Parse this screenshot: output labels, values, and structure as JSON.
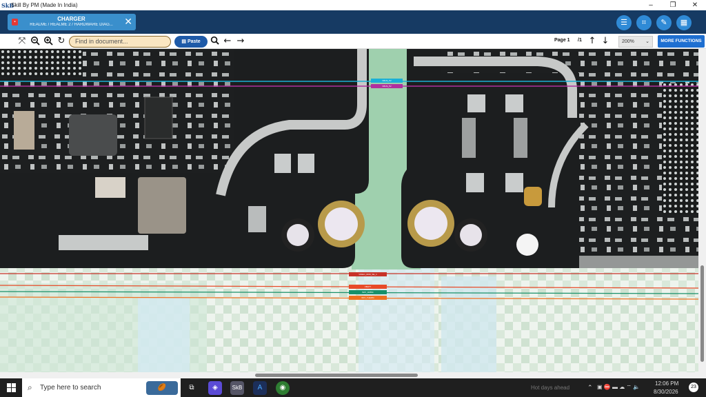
{
  "window": {
    "app_icon": "SkB",
    "title": "Skill By PM (Made In India)",
    "controls": [
      "minimize-icon",
      "restore-icon",
      "close-icon"
    ]
  },
  "header": {
    "doc_tab": {
      "title": "CHARGER",
      "subtitle": "REALME / REALME 2 / HARDWARE DIAG...",
      "close": "✕"
    },
    "buttons": [
      "menu-icon",
      "crop-icon",
      "edit-icon",
      "grid-icon"
    ]
  },
  "toolbar": {
    "search_placeholder": "Find in document...",
    "paste_label": "Paste",
    "page_label": "Page 1",
    "page_total": "/1",
    "zoom_value": "200%",
    "more_label": "MORE FUNCTIONS"
  },
  "viewer": {
    "net_labels": [
      {
        "text": "VBUS_5V",
        "color": "#1ab0d6"
      },
      {
        "text": "VBUS_5V",
        "color": "#b0309e"
      },
      {
        "text": "VIDEO_DDD_SE_1",
        "color": "#c83228"
      },
      {
        "text": "VBATT",
        "color": "#e84a28"
      },
      {
        "text": "BAT_ID/BSI",
        "color": "#18906a"
      },
      {
        "text": "BAT_THERM",
        "color": "#f07020"
      }
    ]
  },
  "taskbar": {
    "search_placeholder": "Type here to search",
    "weather": "Hot days ahead",
    "time": "12:06 PM",
    "date": "8/30/2026",
    "notifications": "23"
  }
}
